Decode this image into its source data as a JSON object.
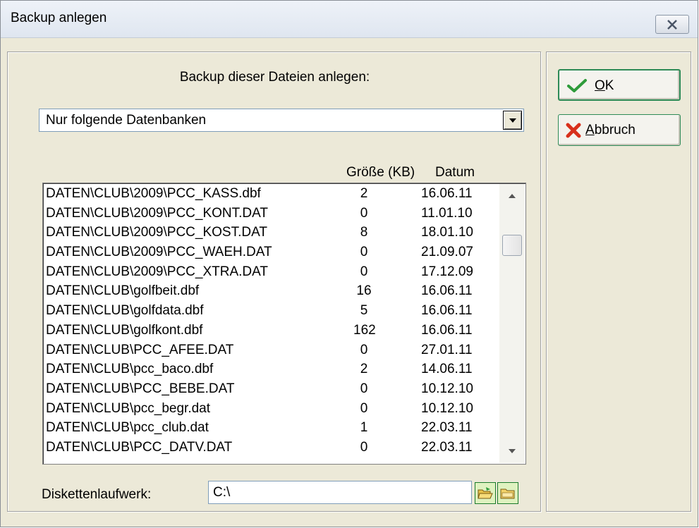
{
  "window": {
    "title": "Backup anlegen"
  },
  "panel": {
    "heading": "Backup dieser Dateien anlegen:",
    "scope_select": {
      "value": "Nur folgende Datenbanken"
    },
    "columns": {
      "size": "Größe (KB)",
      "date": "Datum"
    },
    "files": [
      {
        "name": "DATEN\\CLUB\\2009\\PCC_KASS.dbf",
        "size": "2",
        "date": "16.06.11"
      },
      {
        "name": "DATEN\\CLUB\\2009\\PCC_KONT.DAT",
        "size": "0",
        "date": "11.01.10"
      },
      {
        "name": "DATEN\\CLUB\\2009\\PCC_KOST.DAT",
        "size": "8",
        "date": "18.01.10"
      },
      {
        "name": "DATEN\\CLUB\\2009\\PCC_WAEH.DAT",
        "size": "0",
        "date": "21.09.07"
      },
      {
        "name": "DATEN\\CLUB\\2009\\PCC_XTRA.DAT",
        "size": "0",
        "date": "17.12.09"
      },
      {
        "name": "DATEN\\CLUB\\golfbeit.dbf",
        "size": "16",
        "date": "16.06.11"
      },
      {
        "name": "DATEN\\CLUB\\golfdata.dbf",
        "size": "5",
        "date": "16.06.11"
      },
      {
        "name": "DATEN\\CLUB\\golfkont.dbf",
        "size": "162",
        "date": "16.06.11"
      },
      {
        "name": "DATEN\\CLUB\\PCC_AFEE.DAT",
        "size": "0",
        "date": "27.01.11"
      },
      {
        "name": "DATEN\\CLUB\\pcc_baco.dbf",
        "size": "2",
        "date": "14.06.11"
      },
      {
        "name": "DATEN\\CLUB\\PCC_BEBE.DAT",
        "size": "0",
        "date": "10.12.10"
      },
      {
        "name": "DATEN\\CLUB\\pcc_begr.dat",
        "size": "0",
        "date": "10.12.10"
      },
      {
        "name": "DATEN\\CLUB\\pcc_club.dat",
        "size": "1",
        "date": "22.03.11"
      },
      {
        "name": "DATEN\\CLUB\\PCC_DATV.DAT",
        "size": "0",
        "date": "22.03.11"
      }
    ],
    "drive": {
      "label": "Diskettenlaufwerk:",
      "value": "C:\\"
    }
  },
  "buttons": {
    "ok": {
      "mnemonic": "O",
      "rest": "K"
    },
    "cancel": {
      "mnemonic": "A",
      "rest": "bbruch"
    }
  },
  "icons": {
    "close": "close-icon",
    "dropdown": "chevron-down-icon",
    "scroll_up": "arrow-up-icon",
    "scroll_down": "arrow-down-icon",
    "browse": "folder-open-icon",
    "folder": "folder-icon",
    "ok": "checkmark-icon",
    "cancel": "x-mark-icon"
  },
  "colors": {
    "ok_check": "#2e9b3a",
    "cancel_x": "#d8301c",
    "button_border": "#2e8b57"
  }
}
